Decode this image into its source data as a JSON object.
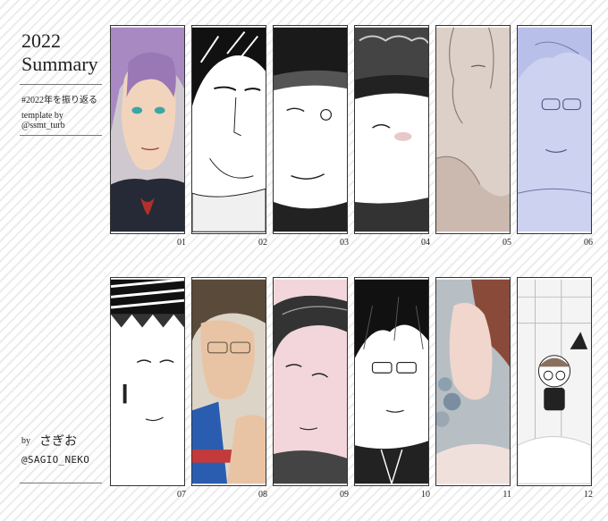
{
  "sidebar": {
    "year": "2022",
    "title": "Summary",
    "hashtag": "#2022年を振り返る",
    "template_line1": "template by",
    "template_line2": "@ssmt_turb",
    "by": "by",
    "author": "さぎお",
    "handle": "@SAGIO_NEKO"
  },
  "panels": [
    {
      "number": "01",
      "subject": "purple-haired man, teal eyes, dark high-collar coat",
      "style": "color"
    },
    {
      "number": "02",
      "subject": "black-haired man, line art",
      "style": "monochrome"
    },
    {
      "number": "03",
      "subject": "man in cap, screentone",
      "style": "monochrome"
    },
    {
      "number": "04",
      "subject": "man in textured hat, blushing",
      "style": "monochrome"
    },
    {
      "number": "05",
      "subject": "curly-haired man, sepia sketch",
      "style": "tinted"
    },
    {
      "number": "06",
      "subject": "man with glasses, blue sketch",
      "style": "tinted"
    },
    {
      "number": "07",
      "subject": "man with striped headband, earring",
      "style": "monochrome"
    },
    {
      "number": "08",
      "subject": "man with glasses, blue tracksuit",
      "style": "color"
    },
    {
      "number": "09",
      "subject": "dark-haired man, pink background",
      "style": "monochrome"
    },
    {
      "number": "10",
      "subject": "man with glasses, black hair",
      "style": "monochrome"
    },
    {
      "number": "11",
      "subject": "red-haired man, flowers",
      "style": "color"
    },
    {
      "number": "12",
      "subject": "chibi boy with glasses and hat",
      "style": "monochrome"
    }
  ]
}
